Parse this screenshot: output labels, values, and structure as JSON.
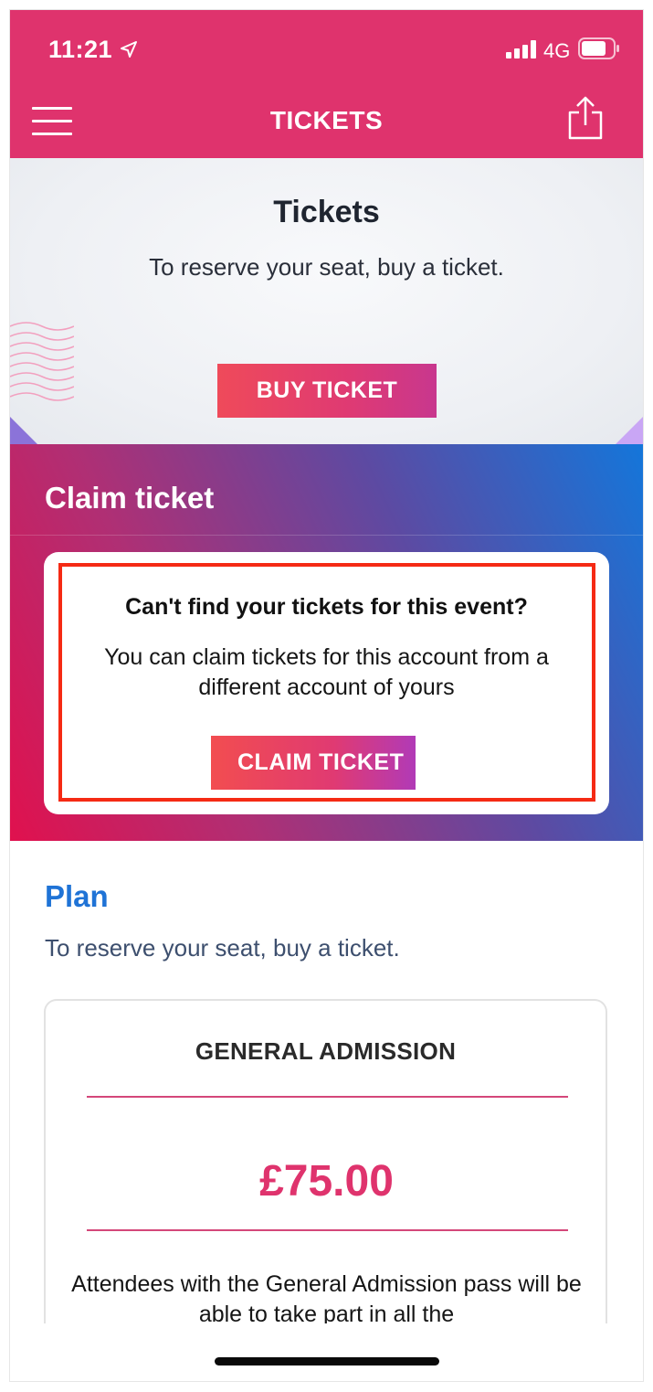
{
  "status_bar": {
    "time": "11:21",
    "network": "4G"
  },
  "nav": {
    "title": "TICKETS"
  },
  "hero": {
    "title": "Tickets",
    "subtitle": "To reserve your seat, buy a ticket.",
    "buy_button_label": "BUY TICKET"
  },
  "claim": {
    "heading": "Claim ticket",
    "card_title": "Can't find your tickets for this event?",
    "card_text": "You can claim tickets for this account from a different account of yours",
    "button_label": "CLAIM TICKET"
  },
  "plan": {
    "title": "Plan",
    "subtitle": "To reserve your seat, buy a ticket.",
    "card": {
      "title": "GENERAL ADMISSION",
      "price": "£75.00",
      "description": "Attendees with the General Admission pass will be able to take part in all the"
    }
  },
  "colors": {
    "brand_pink": "#df336d",
    "plan_blue": "#1f73d6",
    "highlight_red": "#f52a14"
  },
  "icons": {
    "menu": "hamburger-menu-icon",
    "share": "share-icon",
    "location": "location-arrow-icon",
    "signal": "cellular-signal-icon",
    "battery": "battery-icon"
  }
}
